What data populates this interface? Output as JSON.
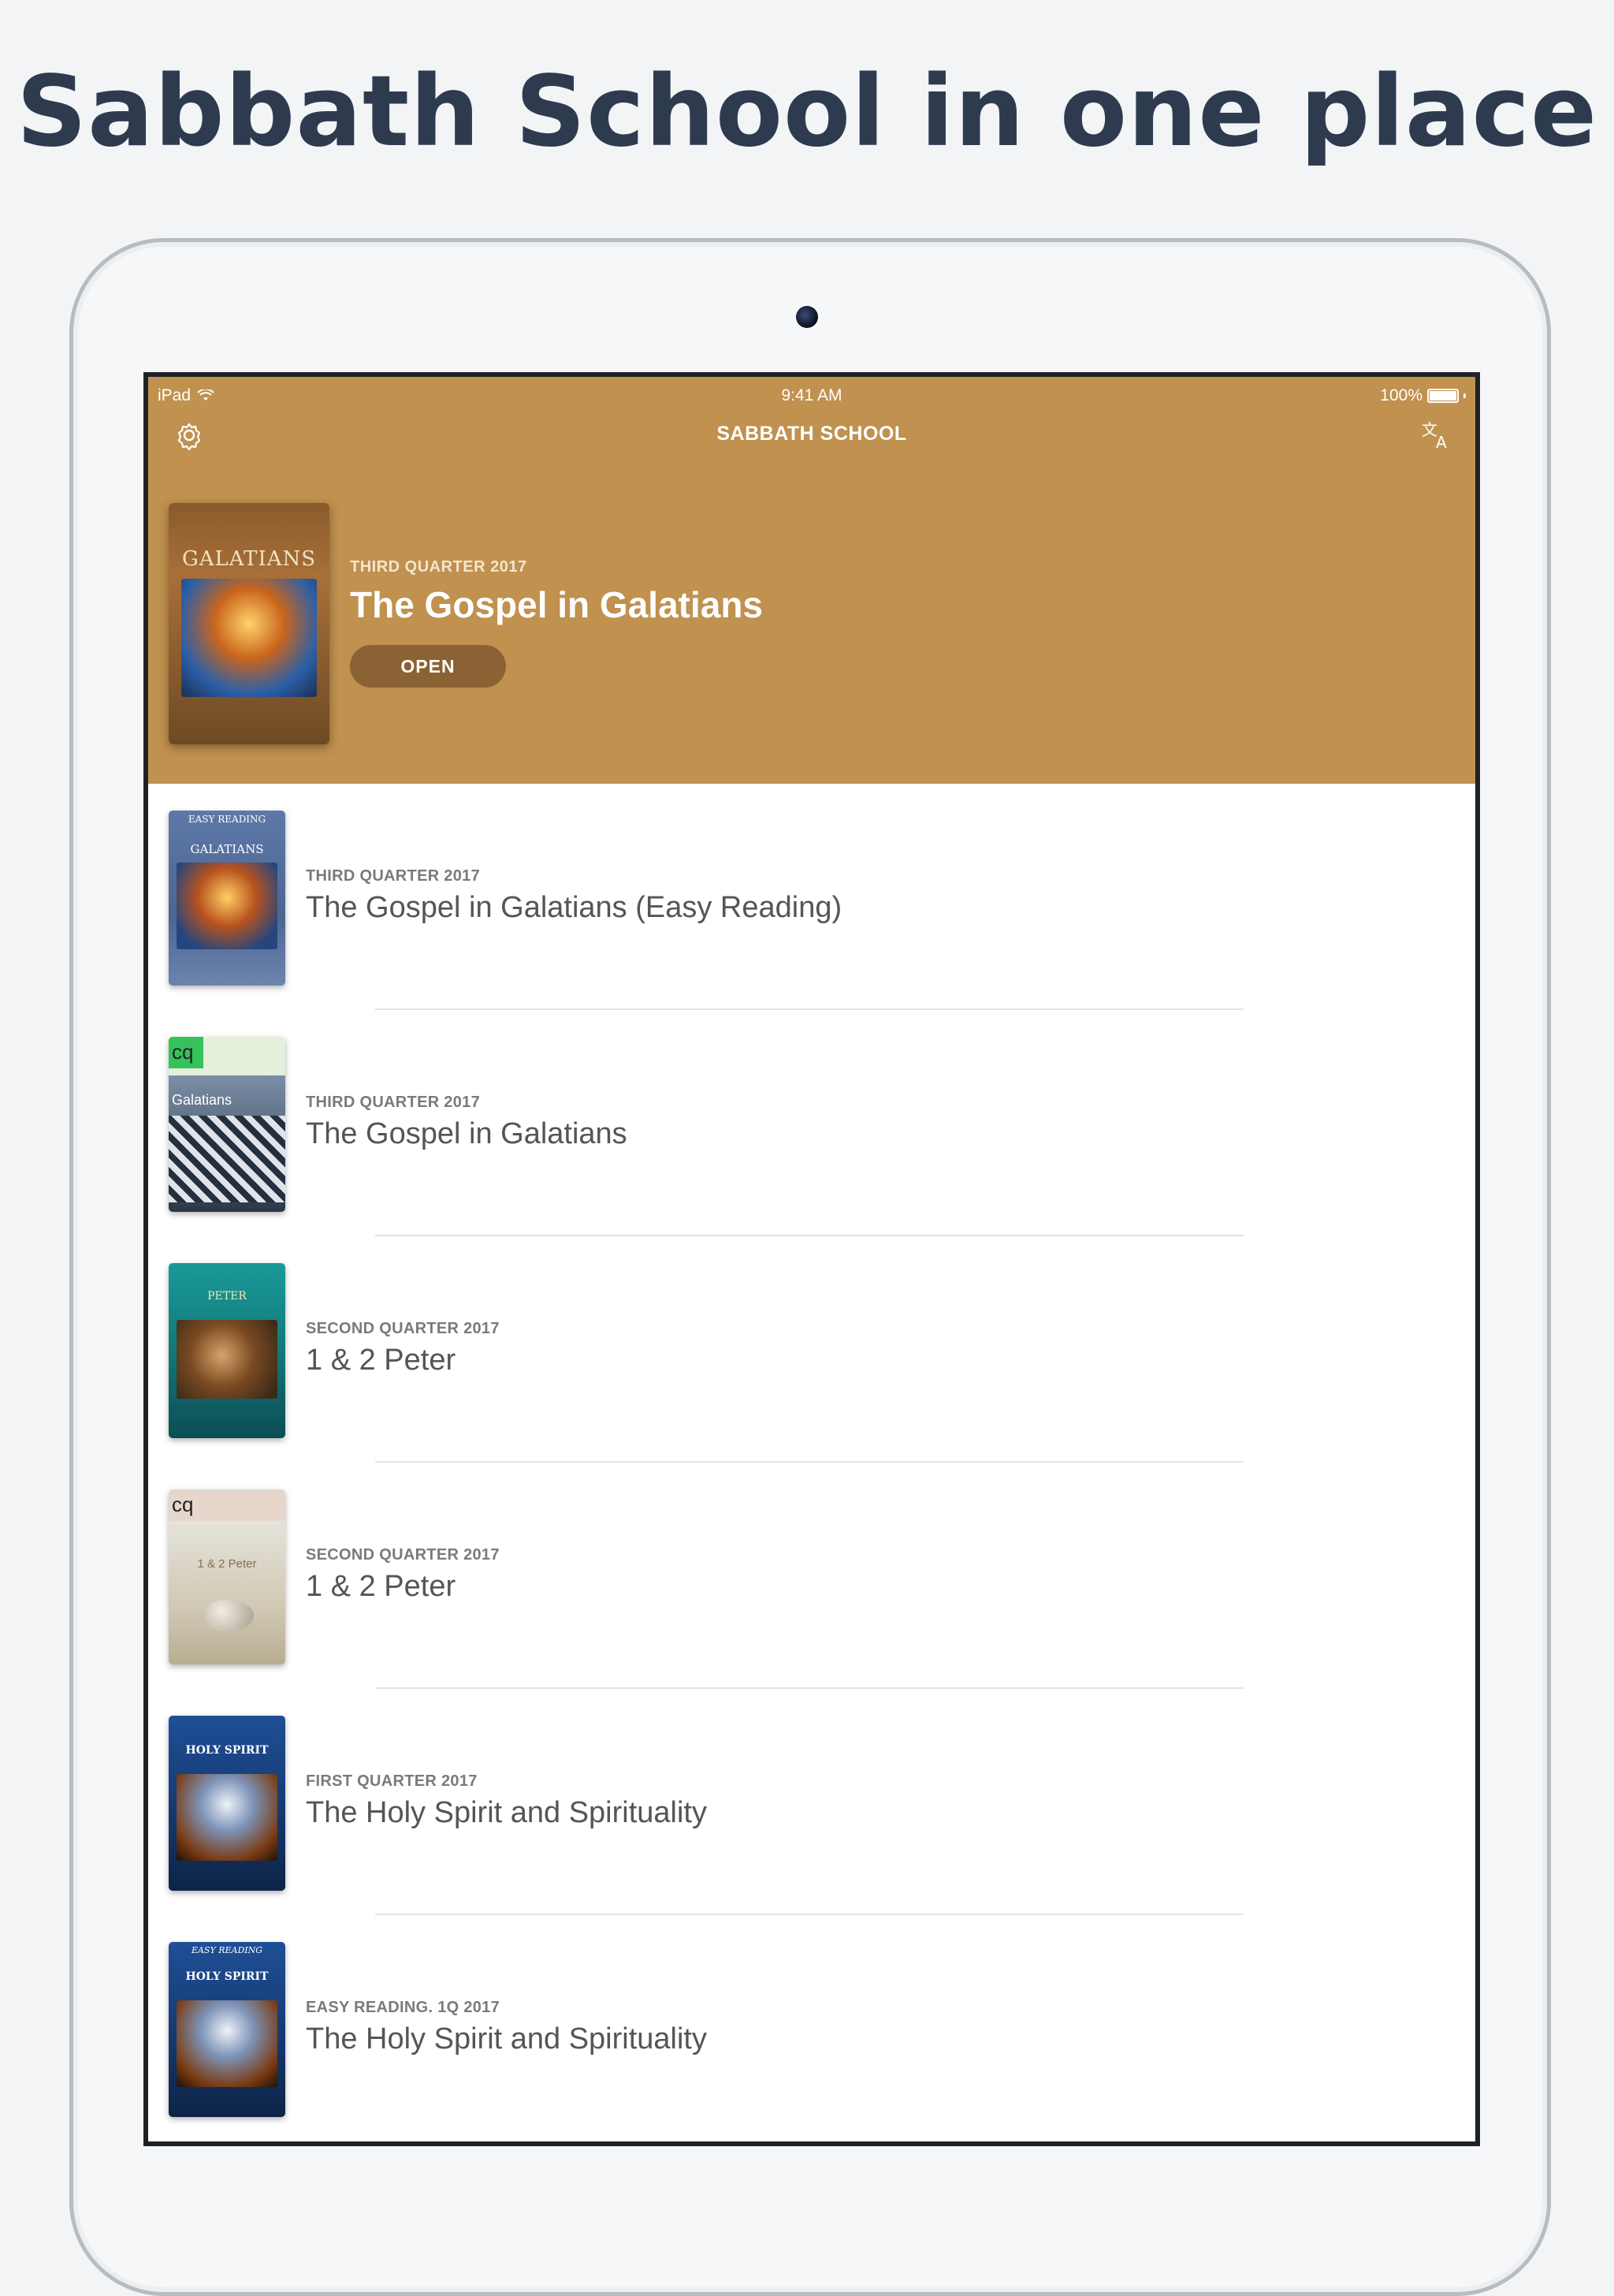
{
  "headline": "Sabbath School in one place",
  "status_bar": {
    "device": "iPad",
    "time": "9:41 AM",
    "battery": "100%"
  },
  "navbar": {
    "title": "SABBATH SCHOOL",
    "left_icon": "gear-icon",
    "right_icon": "translate-icon"
  },
  "featured": {
    "quarter": "THIRD QUARTER 2017",
    "title": "The Gospel in Galatians",
    "open_label": "OPEN",
    "cover_text": "GALATIANS"
  },
  "lessons": [
    {
      "quarter": "THIRD QUARTER 2017",
      "title": "The Gospel in Galatians (Easy Reading)",
      "cover_top": "EASY READING",
      "cover_text": "GALATIANS"
    },
    {
      "quarter": "THIRD QUARTER 2017",
      "title": "The Gospel in Galatians",
      "cover_top": "cq",
      "cover_text": "Galatians"
    },
    {
      "quarter": "SECOND QUARTER 2017",
      "title": "1 & 2 Peter",
      "cover_top": "",
      "cover_text": "PETER"
    },
    {
      "quarter": "SECOND QUARTER 2017",
      "title": "1 & 2 Peter",
      "cover_top": "cq",
      "cover_text": "1 & 2 Peter"
    },
    {
      "quarter": "FIRST QUARTER 2017",
      "title": "The Holy Spirit and Spirituality",
      "cover_top": "",
      "cover_text": "HOLY SPIRIT"
    },
    {
      "quarter": "EASY READING. 1Q 2017",
      "title": "The Holy Spirit and Spirituality",
      "cover_top": "EASY READING",
      "cover_text": "HOLY SPIRIT"
    }
  ],
  "colors": {
    "hero": "#c0914f",
    "open_button": "#8b6233",
    "headline": "#2e3b4f"
  }
}
